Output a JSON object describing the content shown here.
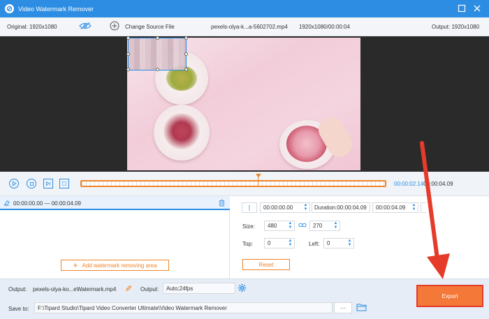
{
  "app": {
    "title": "Video Watermark Remover"
  },
  "infobar": {
    "original": "Original: 1920x1080",
    "change_source": "Change Source File",
    "filename": "pexels-olya-k...a-5602702.mp4",
    "meta": "1920x1080/00:00:04",
    "output": "Output: 1920x1080"
  },
  "playback": {
    "current_time": "00:00:02.14",
    "total_time": "00:00:04.09",
    "playhead_fraction": 0.58
  },
  "segment": {
    "range": "00:00:00.00 — 00:00:04.09"
  },
  "add_area_label": "Add watermark removing area",
  "settings": {
    "start_value": "00:00:00.00",
    "duration_label": "Duration:",
    "duration_value": "00:00:04.09",
    "end_value": "00:00:04.09",
    "size_label": "Size:",
    "width": "480",
    "height": "270",
    "top_label": "Top:",
    "top_value": "0",
    "left_label": "Left:",
    "left_value": "0",
    "reset_label": "Reset"
  },
  "bottom": {
    "output_label": "Output:",
    "output_file": "pexels-olya-ko...eWatermark.mp4",
    "output2_label": "Output:",
    "output_format": "Auto;24fps",
    "save_label": "Save to:",
    "save_path": "F:\\Tipard Studio\\Tipard Video Converter Ultimate\\Video Watermark Remover",
    "more_label": "···",
    "export_label": "Export"
  },
  "colors": {
    "accent": "#2d8de3",
    "orange": "#f08326",
    "export": "#f47838",
    "arrow": "#e53b2a"
  }
}
